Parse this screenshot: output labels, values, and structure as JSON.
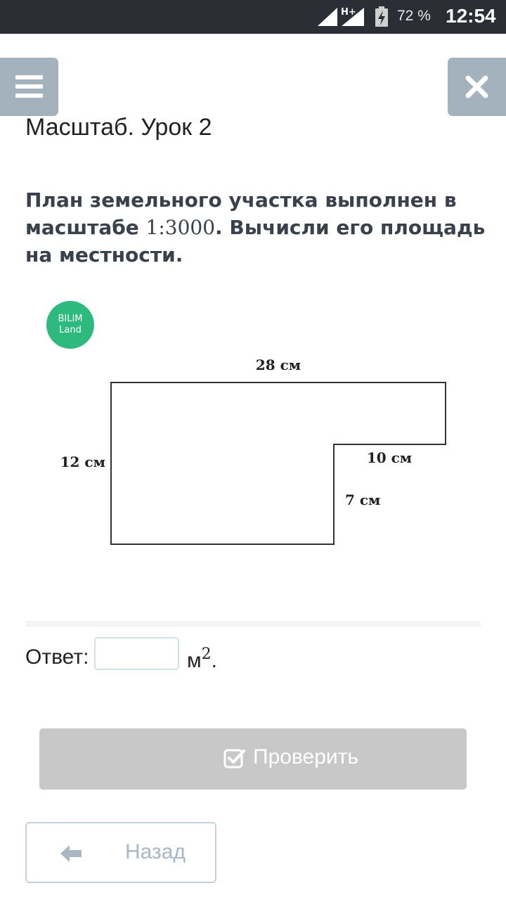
{
  "status_bar": {
    "network_label": "H+",
    "battery_percent": "72 %",
    "time": "12:54"
  },
  "header": {
    "lesson_title": "Масштаб. Урок 2"
  },
  "task": {
    "question_part1": "План земельного участка выполнен в масштабе ",
    "scale": "1:3000",
    "question_part2": ". Вычисли его площадь на местности.",
    "logo_line1": "BILIM",
    "logo_line2": "Land",
    "figure_labels": {
      "top": "28 см",
      "left": "12 см",
      "inner_horizontal": "10 см",
      "inner_vertical": "7 см"
    }
  },
  "answer": {
    "label": "Ответ:",
    "value": "",
    "unit": "м",
    "unit_power": "2",
    "unit_suffix": "."
  },
  "buttons": {
    "check_label": "Проверить",
    "back_label": "Назад"
  },
  "colors": {
    "status_bar": "#2b2f35",
    "nav_button": "#a4b2bd",
    "logo": "#2eb97e",
    "check_button": "#c8c8c8",
    "back_border": "#c5d2db"
  }
}
